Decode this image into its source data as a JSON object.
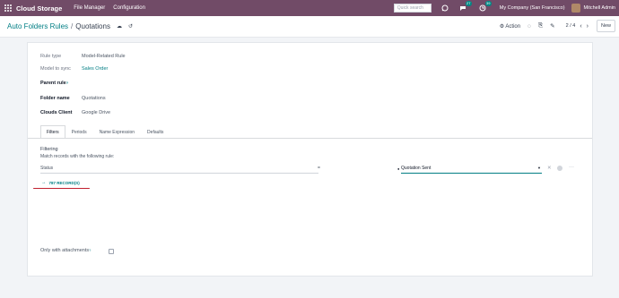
{
  "navbar": {
    "brand": "Cloud Storage",
    "menus": [
      "File Manager",
      "Configuration"
    ],
    "search_placeholder": "Quick search",
    "messages_badge": "27",
    "activities_badge": "39",
    "company": "My Company (San Francisco)",
    "user": "Mitchell Admin"
  },
  "control_panel": {
    "breadcrumb_parent": "Auto Folders Rules",
    "breadcrumb_separator": "/",
    "breadcrumb_current": "Quotations",
    "action_label": "⚙ Action",
    "pager": "2 / 4",
    "new_label": "New"
  },
  "form": {
    "rule_type_label": "Rule type",
    "rule_type_value": "Model-Related Rule",
    "model_label": "Model to sync",
    "model_value": "Sales Order",
    "parent_rule_label": "Parent rule",
    "parent_rule_marker": "?",
    "folder_name_label": "Folder name",
    "folder_name_value": "Quotations",
    "cloud_client_label": "Clouds Client",
    "cloud_client_value": "Google Drive"
  },
  "tabs": [
    "Filters",
    "Periods",
    "Name Expression",
    "Defaults"
  ],
  "filters": {
    "title": "Filtering",
    "subtitle": "Match records with the following rule:",
    "field": "Status",
    "operator": "=",
    "value": "Quotation Sent",
    "records_label": "787 RECORD(S)"
  },
  "attachments": {
    "label": "Only with attachments",
    "marker": "?",
    "checked": false
  }
}
